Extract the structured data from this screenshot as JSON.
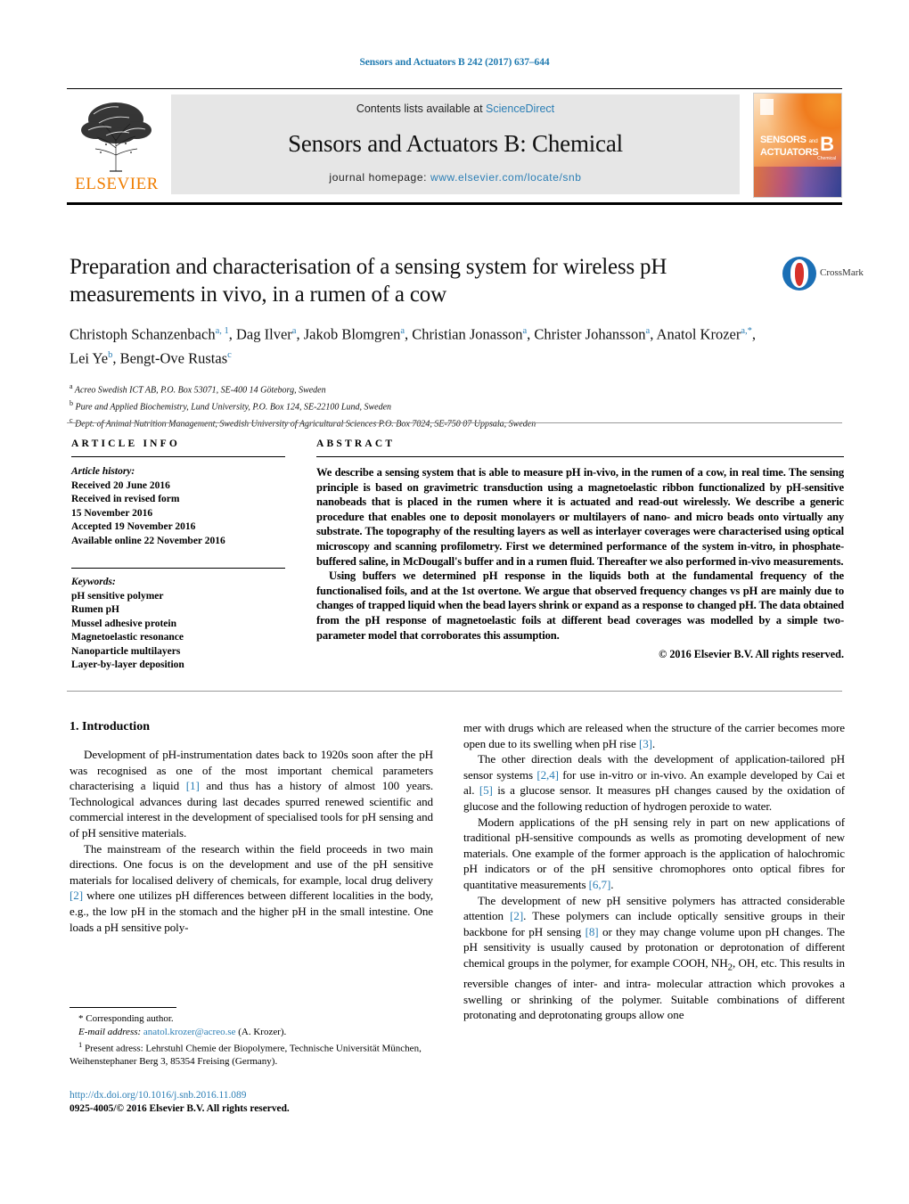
{
  "running_head": "Sensors and Actuators B 242 (2017) 637–644",
  "masthead": {
    "publisher": "ELSEVIER",
    "contents_prefix": "Contents lists available at ",
    "contents_link": "ScienceDirect",
    "journal_title": "Sensors and Actuators B: Chemical",
    "homepage_prefix": "journal homepage: ",
    "homepage_url": "www.elsevier.com/locate/snb",
    "cover": {
      "line1": "SENSORS",
      "line1_small": "and",
      "line2": "ACTUATORS",
      "volume_letter": "B",
      "volume_sub": "Chemical"
    }
  },
  "article": {
    "title": "Preparation and characterisation of a sensing system for wireless pH measurements in vivo, in a rumen of a cow",
    "crossmark_label": "CrossMark",
    "authors_line1": "Christoph Schanzenbach",
    "authors_html": "Christoph Schanzenbach<sup>a, 1</sup>, Dag Ilver<sup>a</sup>, Jakob Blomgren<sup>a</sup>, Christian Jonasson<sup>a</sup>, Christer Johansson<sup>a</sup>, Anatol Krozer<sup>a,*</sup>, Lei Ye<sup>b</sup>, Bengt-Ove Rustas<sup>c</sup>",
    "affiliations": [
      "Acreo Swedish ICT AB, P.O. Box 53071, SE-400 14 Göteborg, Sweden",
      "Pure and Applied Biochemistry, Lund University, P.O. Box 124, SE-22100 Lund, Sweden",
      "Dept. of Animal Nutrition Management, Swedish University of Agricultural Sciences P.O. Box 7024, SE-750 07 Uppsala, Sweden"
    ],
    "affiliation_markers": [
      "a",
      "b",
      "c"
    ]
  },
  "article_info": {
    "heading": "ARTICLE INFO",
    "history_label": "Article history:",
    "history": [
      "Received 20 June 2016",
      "Received in revised form",
      "15 November 2016",
      "Accepted 19 November 2016",
      "Available online 22 November 2016"
    ],
    "keywords_label": "Keywords:",
    "keywords": [
      "pH sensitive polymer",
      "Rumen pH",
      "Mussel adhesive protein",
      "Magnetoelastic resonance",
      "Nanoparticle multilayers",
      "Layer-by-layer deposition"
    ]
  },
  "abstract": {
    "heading": "ABSTRACT",
    "paragraph1": "We describe a sensing system that is able to measure pH in-vivo, in the rumen of a cow, in real time. The sensing principle is based on gravimetric transduction using a magnetoelastic ribbon functionalized by pH-sensitive nanobeads that is placed in the rumen where it is actuated and read-out wirelessly. We describe a generic procedure that enables one to deposit monolayers or multilayers of nano- and micro beads onto virtually any substrate. The topography of the resulting layers as well as interlayer coverages were characterised using optical microscopy and scanning profilometry. First we determined performance of the system in-vitro, in phosphate-buffered saline, in McDougall's buffer and in a rumen fluid. Thereafter we also performed in-vivo measurements.",
    "paragraph2": "Using buffers we determined pH response in the liquids both at the fundamental frequency of the functionalised foils, and at the 1st overtone. We argue that observed frequency changes vs pH are mainly due to changes of trapped liquid when the bead layers shrink or expand as a response to changed pH. The data obtained from the pH response of magnetoelastic foils at different bead coverages was modelled by a simple two-parameter model that corroborates this assumption.",
    "copyright": "© 2016 Elsevier B.V. All rights reserved."
  },
  "body": {
    "section_heading": "1. Introduction",
    "left_paragraphs": [
      "Development of pH-instrumentation dates back to 1920s soon after the pH was recognised as one of the most important chemical parameters characterising a liquid [1] and thus has a history of almost 100 years. Technological advances during last decades spurred renewed scientific and commercial interest in the development of specialised tools for pH sensing and of pH sensitive materials.",
      "The mainstream of the research within the field proceeds in two main directions. One focus is on the development and use of the pH sensitive materials for localised delivery of chemicals, for example, local drug delivery [2] where one utilizes pH differences between different localities in the body, e.g., the low pH in the stomach and the higher pH in the small intestine. One loads a pH sensitive poly-"
    ],
    "right_paragraphs": [
      "mer with drugs which are released when the structure of the carrier becomes more open due to its swelling when pH rise [3].",
      "The other direction deals with the development of application-tailored pH sensor systems [2,4] for use in-vitro or in-vivo. An example developed by Cai et al. [5] is a glucose sensor. It measures pH changes caused by the oxidation of glucose and the following reduction of hydrogen peroxide to water.",
      "Modern applications of the pH sensing rely in part on new applications of traditional pH-sensitive compounds as wells as promoting development of new materials. One example of the former approach is the application of halochromic pH indicators or of the pH sensitive chromophores onto optical fibres for quantitative measurements [6,7].",
      "The development of new pH sensitive polymers has attracted considerable attention [2]. These polymers can include optically sensitive groups in their backbone for pH sensing [8] or they may change volume upon pH changes. The pH sensitivity is usually caused by protonation or deprotonation of different chemical groups in the polymer, for example COOH, NH2, OH, etc. This results in reversible changes of inter- and intra- molecular attraction which provokes a swelling or shrinking of the polymer. Suitable combinations of different protonating and deprotonating groups allow one"
    ]
  },
  "footnotes": {
    "corresponding": "* Corresponding author.",
    "email_label": "E-mail address:",
    "email": "anatol.krozer@acreo.se",
    "email_owner": "(A. Krozer).",
    "present_address": "Present adress: Lehrstuhl Chemie der Biopolymere, Technische Universität München, Weihenstephaner Berg 3, 85354 Freising (Germany).",
    "present_address_marker": "1"
  },
  "imprint": {
    "doi": "http://dx.doi.org/10.1016/j.snb.2016.11.089",
    "issn_line": "0925-4005/© 2016 Elsevier B.V. All rights reserved."
  },
  "colors": {
    "link_blue": "#2b7eb5",
    "elsevier_orange": "#ef7d00",
    "masthead_grey": "#e6e6e6"
  }
}
